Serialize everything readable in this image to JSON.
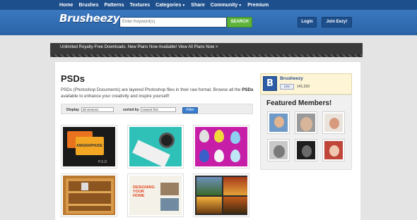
{
  "nav": {
    "items": [
      {
        "label": "Home",
        "caret": ""
      },
      {
        "label": "Brushes",
        "caret": ""
      },
      {
        "label": "Patterns",
        "caret": ""
      },
      {
        "label": "Textures",
        "caret": ""
      },
      {
        "label": "Categories",
        "caret": "▼"
      },
      {
        "label": "Share",
        "caret": ""
      },
      {
        "label": "Community",
        "caret": "▼"
      },
      {
        "label": "Premium",
        "caret": ""
      }
    ]
  },
  "header": {
    "logo": "Brusheezy",
    "search_placeholder": "Enter Keyword(s)",
    "search_button": "SEARCH",
    "login_label": "Login",
    "join_label": "Join Eezy!"
  },
  "promo": {
    "text": "Unlimited Royalty-Free Downloads. New Plans Now Available! View All Plans Now >"
  },
  "main": {
    "title": "PSDs",
    "desc_1": "PSDs (Photoshop Documents) are layered Photoshop files in their raw format. Browse all the ",
    "desc_bold": "PSDs",
    "desc_2": " available to enhance your creativity and inspire yourself!",
    "filters": {
      "display_label": "Display",
      "display_value": "all versions",
      "sort_label": "sorted by",
      "sort_value": "newest first",
      "filter_button": "Filter"
    },
    "thumb_texts": {
      "anigraphuse": "ANIGRAPHUSE",
      "psd": "P.S.D",
      "designing_1": "DESIGNING",
      "designing_2": "YOUR",
      "designing_3": "HOME"
    }
  },
  "sidebar": {
    "fb_page_name": "Brusheezy",
    "fb_logo_letter": "B",
    "fb_like_label": "Like",
    "fb_like_count": "141,310",
    "featured_title": "Featured Members!"
  },
  "colors": {
    "nav_bg": "#1d4f8c",
    "header_bg": "#2c66ab",
    "search_green": "#5eb33b",
    "filter_blue": "#3b7dd0"
  }
}
